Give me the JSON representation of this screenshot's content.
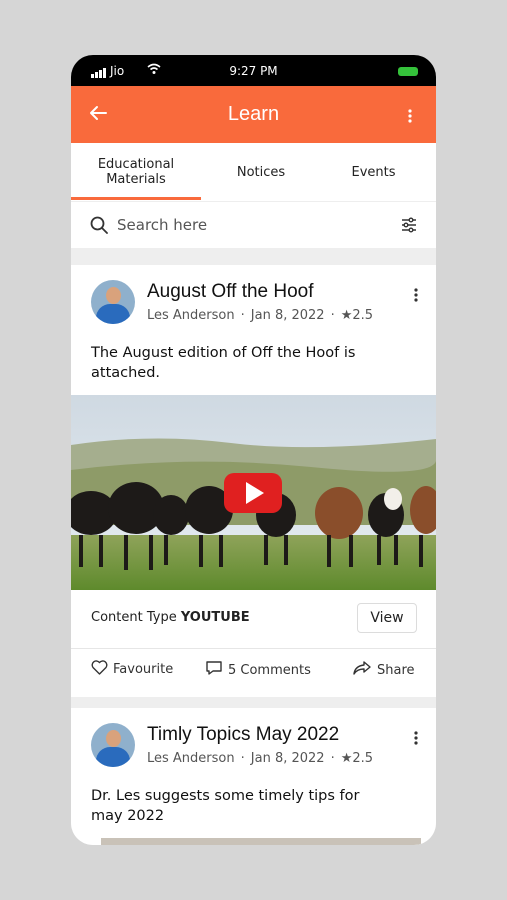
{
  "status_bar": {
    "carrier": "Jio",
    "time": "9:27 PM",
    "signal_icon": "signal-bars-icon",
    "wifi_icon": "wifi-icon",
    "battery_icon": "battery-icon",
    "battery_color": "#35c23b"
  },
  "app_bar": {
    "title": "Learn",
    "back_icon": "arrow-left-icon",
    "menu_icon": "more-vertical-icon",
    "color": "#f96a3c"
  },
  "tabs": [
    {
      "line1": "Educational",
      "line2": "Materials",
      "active": true
    },
    {
      "line1": "Notices",
      "line2": "",
      "active": false
    },
    {
      "line1": "Events",
      "line2": "",
      "active": false
    }
  ],
  "search": {
    "placeholder": "Search here",
    "search_icon": "search-icon",
    "filter_icon": "filter-sliders-icon"
  },
  "posts": [
    {
      "title": "August Off the Hoof",
      "author": "Les Anderson",
      "date": "Jan 8, 2022",
      "rating": "2.5",
      "description": "The August edition of Off the Hoof is attached.",
      "content_type_label": "Content Type",
      "content_type_value": "YOUTUBE",
      "view_label": "View",
      "favourite_label": "Favourite",
      "comments_label": "5 Comments",
      "share_label": "Share",
      "media_icon": "youtube-play-icon"
    },
    {
      "title": "Timly Topics May 2022",
      "author": "Les Anderson",
      "date": "Jan 8, 2022",
      "rating": "2.5",
      "description": "Dr. Les suggests some timely tips for may 2022"
    }
  ],
  "separator": "·",
  "star": "★"
}
